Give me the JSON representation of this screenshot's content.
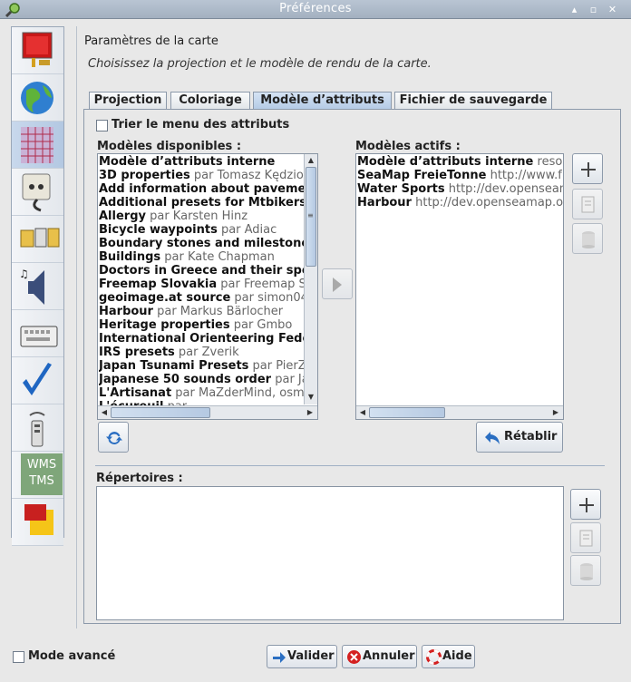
{
  "window": {
    "title": "Préférences",
    "app_icon": "magnifier-josm-icon"
  },
  "sidebar": {
    "items": [
      {
        "name": "display-settings-icon"
      },
      {
        "name": "globe-icon"
      },
      {
        "name": "map-grid-icon",
        "selected": true
      },
      {
        "name": "plug-connection-icon"
      },
      {
        "name": "folders-icon"
      },
      {
        "name": "speaker-audio-icon"
      },
      {
        "name": "keyboard-icon"
      },
      {
        "name": "checkmark-validator-icon"
      },
      {
        "name": "remote-control-icon"
      },
      {
        "name": "wms-tms-icon",
        "text1": "WMS",
        "text2": "TMS"
      },
      {
        "name": "imagery-offset-icon"
      }
    ]
  },
  "header": {
    "title": "Paramètres de la carte",
    "subtitle": "Choisissez la projection et le modèle de rendu de la carte."
  },
  "tabs": [
    "Projection",
    "Coloriage",
    "Modèle d’attributs",
    "Fichier de sauvegarde"
  ],
  "sort_checkbox": {
    "label": "Trier le menu des attributs",
    "checked": false
  },
  "available": {
    "label": "Modèles disponibles :",
    "items": [
      {
        "name": "Modèle d’attributs interne",
        "detail": ""
      },
      {
        "name": "3D properties",
        "detail": " par Tomasz Kędziora"
      },
      {
        "name": "Add information about pavement",
        "detail": ""
      },
      {
        "name": "Additional presets for Mtbikers",
        "detail": " p"
      },
      {
        "name": "Allergy",
        "detail": " par Karsten Hinz"
      },
      {
        "name": "Bicycle waypoints",
        "detail": " par Adiac"
      },
      {
        "name": "Boundary stones and milestones",
        "detail": ""
      },
      {
        "name": "Buildings",
        "detail": " par Kate Chapman"
      },
      {
        "name": "Doctors in Greece and their spec",
        "detail": ""
      },
      {
        "name": "Freemap Slovakia",
        "detail": " par Freemap Slo"
      },
      {
        "name": "geoimage.at source",
        "detail": " par simon04"
      },
      {
        "name": "Harbour",
        "detail": " par Markus Bärlocher"
      },
      {
        "name": "Heritage properties",
        "detail": " par Gmbo"
      },
      {
        "name": "International Orienteering Fede",
        "detail": ""
      },
      {
        "name": "IRS presets",
        "detail": " par Zverik"
      },
      {
        "name": "Japan Tsunami Presets",
        "detail": " par PierZe"
      },
      {
        "name": "Japanese 50 sounds order",
        "detail": " par Jap"
      },
      {
        "name": "L'Artisanat",
        "detail": " par MaZderMind, osm@"
      },
      {
        "name": "L'écureuil",
        "detail": " par"
      }
    ]
  },
  "active": {
    "label": "Modèles actifs :",
    "items": [
      {
        "name": "Modèle d’attributs interne",
        "detail": " resou"
      },
      {
        "name": "SeaMap FreieTonne",
        "detail": " http://www.fre"
      },
      {
        "name": "Water Sports",
        "detail": " http://dev.openseam"
      },
      {
        "name": "Harbour",
        "detail": " http://dev.openseamap.or"
      }
    ]
  },
  "buttons": {
    "restore": "Rétablir",
    "validate": "Valider",
    "cancel": "Annuler",
    "help": "Aide"
  },
  "directories": {
    "label": "Répertoires :"
  },
  "advanced": {
    "label": "Mode avancé",
    "checked": false
  },
  "colors": {
    "accent": "#2b6fc2",
    "titlebar": "#a3b0c0"
  }
}
